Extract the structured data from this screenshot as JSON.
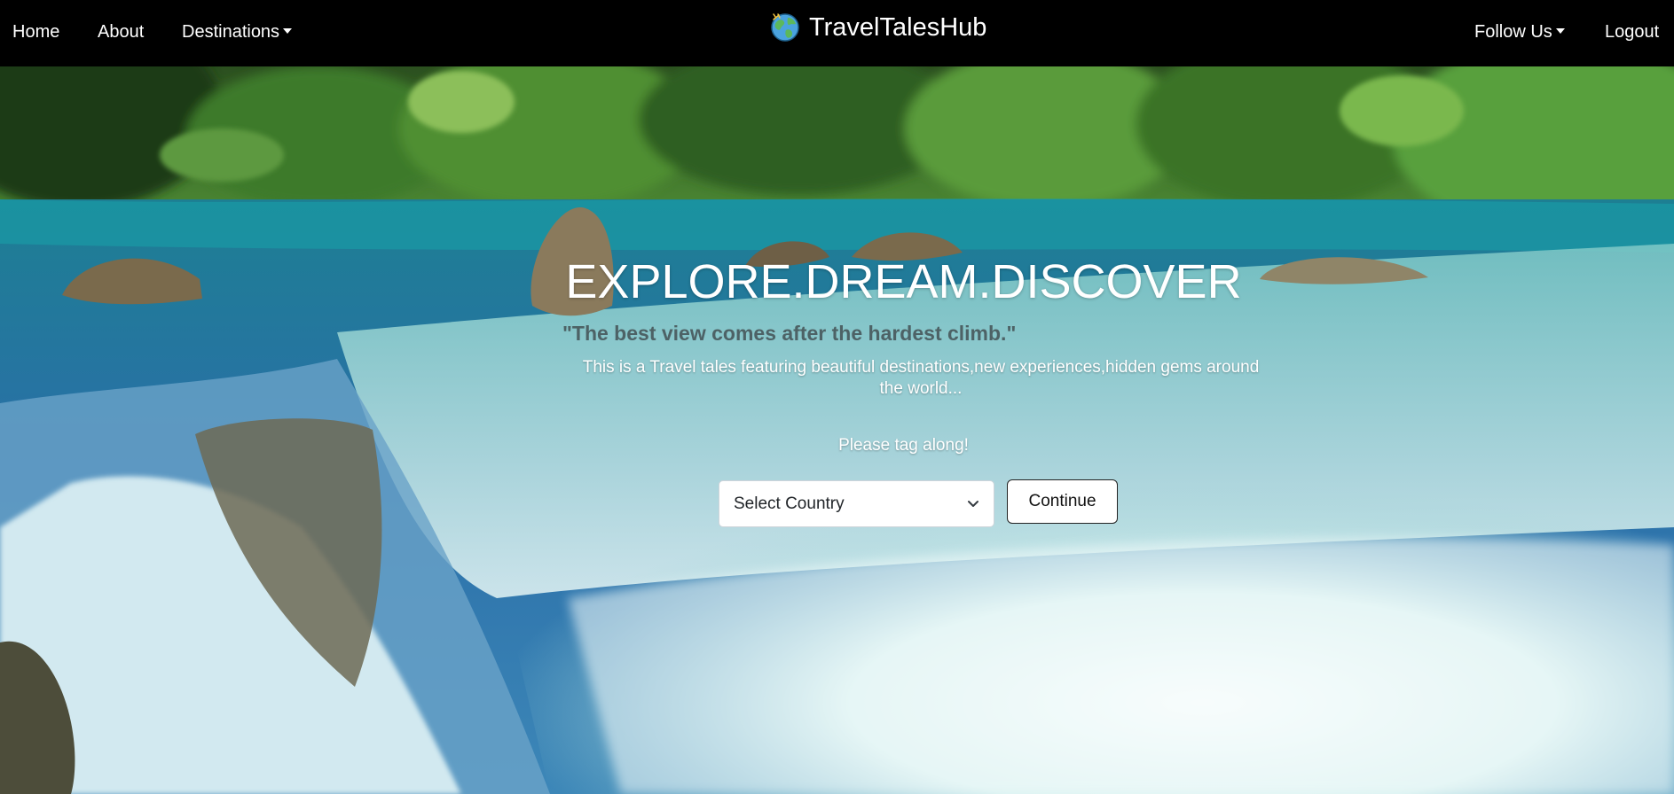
{
  "nav": {
    "home": "Home",
    "about": "About",
    "destinations": "Destinations",
    "brand": "TravelTalesHub",
    "follow_us": "Follow Us",
    "logout": "Logout"
  },
  "hero": {
    "headline": "EXPLORE.DREAM.DISCOVER",
    "quote": "\"The best view comes after the hardest climb.\"",
    "description": "This is a Travel tales featuring beautiful destinations,new experiences,hidden gems around the world...",
    "tagline": "Please tag along!",
    "country_select": {
      "selected": "Select Country"
    },
    "continue_label": "Continue"
  },
  "colors": {
    "navbar_bg": "#000000",
    "text_light": "#ffffff",
    "quote_text": "#3f4a4d",
    "water": "#2f8fa6",
    "foliage": "#3f7a2c"
  },
  "icons": {
    "brand_logo": "globe-icon",
    "dropdown": "caret-down-icon",
    "select_arrow": "chevron-down-icon"
  }
}
